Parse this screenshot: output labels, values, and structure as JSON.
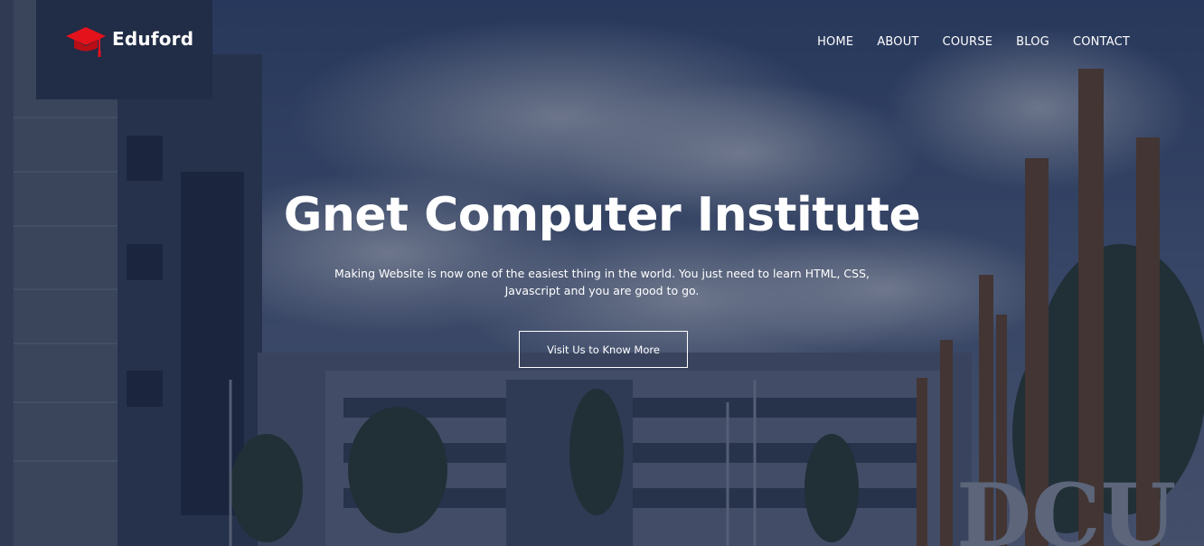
{
  "brand": {
    "name": "Eduford",
    "icon": "graduation-cap-icon",
    "icon_color": "#e3121b"
  },
  "nav": {
    "items": [
      "HOME",
      "ABOUT",
      "COURSE",
      "BLOG",
      "CONTACT"
    ]
  },
  "hero": {
    "title": "Gnet Computer Institute",
    "subtitle": "Making Website is now one of the easiest thing in the world. You just need to learn HTML, CSS, Javascript and you are good to go.",
    "cta_label": "Visit Us to Know More",
    "background_sign": "DCU"
  },
  "colors": {
    "overlay": "#121c3a",
    "text": "#ffffff",
    "accent": "#e3121b"
  }
}
